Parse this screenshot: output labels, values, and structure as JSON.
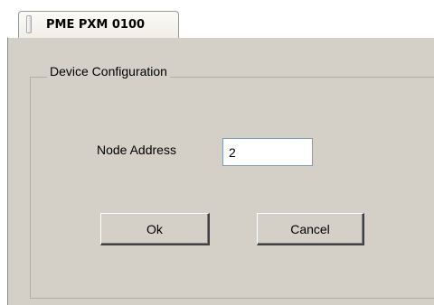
{
  "tab": {
    "label": "PME PXM 0100",
    "icon": "tab-handle-icon"
  },
  "group": {
    "title": "Device Configuration"
  },
  "form": {
    "node_address_label": "Node Address",
    "node_address_value": "2"
  },
  "buttons": {
    "ok_label": "Ok",
    "cancel_label": "Cancel"
  },
  "colors": {
    "panel_background": "#d4d0c8",
    "page_background": "#ffffff",
    "input_border": "#7f9db9"
  }
}
